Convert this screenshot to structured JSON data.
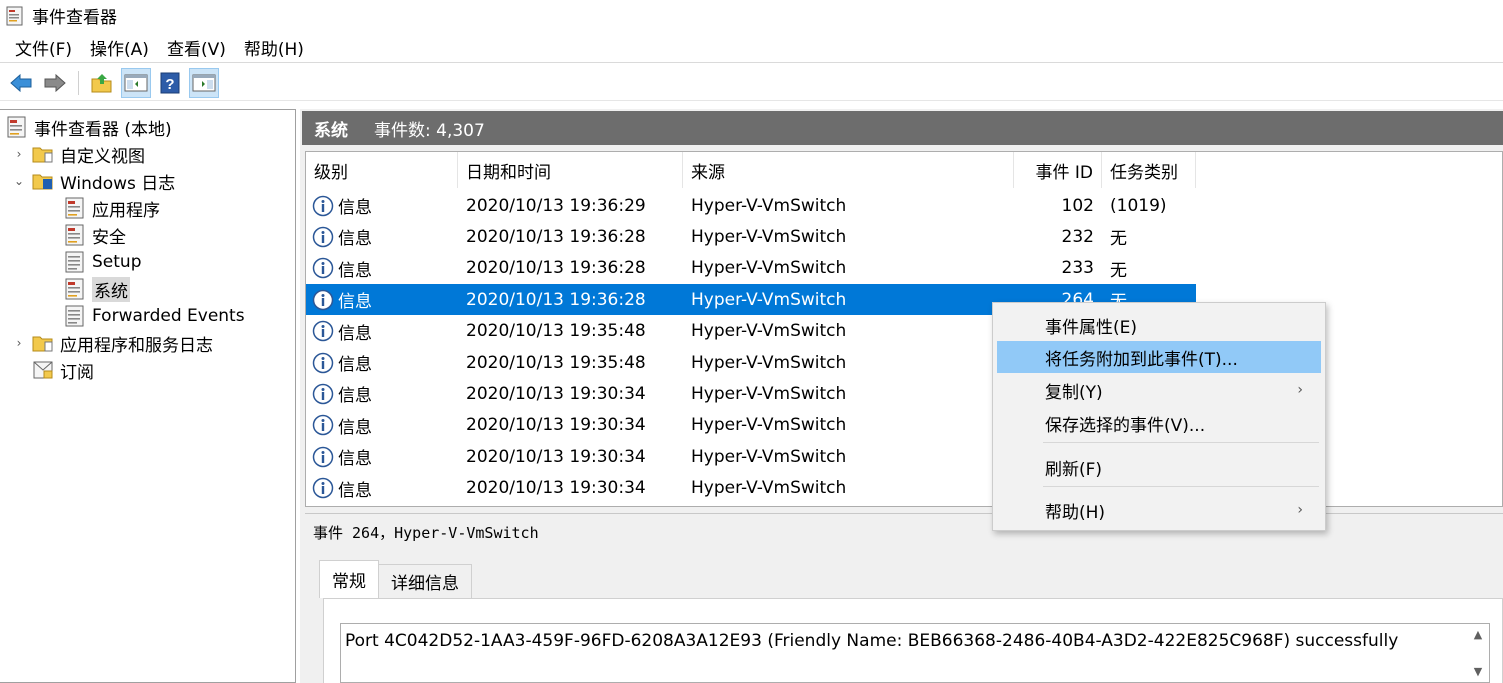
{
  "window": {
    "title": "事件查看器"
  },
  "menu": [
    {
      "label": "文件(F)"
    },
    {
      "label": "操作(A)"
    },
    {
      "label": "查看(V)"
    },
    {
      "label": "帮助(H)"
    }
  ],
  "toolbar": {
    "buttons": [
      "back-icon",
      "forward-icon",
      "folder-up-icon",
      "show-hide-tree-icon",
      "help-icon",
      "show-hide-action-pane-icon"
    ]
  },
  "tree": [
    {
      "label": "事件查看器 (本地)",
      "icon": "event-viewer-icon",
      "level": 0,
      "chev": ""
    },
    {
      "label": "自定义视图",
      "icon": "folder-icon",
      "level": 1,
      "chev": "›"
    },
    {
      "label": "Windows 日志",
      "icon": "windows-logs-icon",
      "level": 1,
      "chev": "⌄"
    },
    {
      "label": "应用程序",
      "icon": "log-icon",
      "level": 2,
      "chev": ""
    },
    {
      "label": "安全",
      "icon": "log-icon",
      "level": 2,
      "chev": ""
    },
    {
      "label": "Setup",
      "icon": "log-icon",
      "level": 2,
      "chev": ""
    },
    {
      "label": "系统",
      "icon": "log-icon",
      "level": 2,
      "chev": "",
      "selected": true
    },
    {
      "label": "Forwarded Events",
      "icon": "log-icon",
      "level": 2,
      "chev": ""
    },
    {
      "label": "应用程序和服务日志",
      "icon": "folder-icon",
      "level": 1,
      "chev": "›"
    },
    {
      "label": "订阅",
      "icon": "subscription-icon",
      "level": 1,
      "chev": ""
    }
  ],
  "list": {
    "title": "系统",
    "count": "事件数: 4,307",
    "columns": [
      "级别",
      "日期和时间",
      "来源",
      "事件 ID",
      "任务类别"
    ],
    "rows": [
      {
        "level": "信息",
        "datetime": "2020/10/13 19:36:29",
        "source": "Hyper-V-VmSwitch",
        "id": "102",
        "task": "(1019)"
      },
      {
        "level": "信息",
        "datetime": "2020/10/13 19:36:28",
        "source": "Hyper-V-VmSwitch",
        "id": "232",
        "task": "无"
      },
      {
        "level": "信息",
        "datetime": "2020/10/13 19:36:28",
        "source": "Hyper-V-VmSwitch",
        "id": "233",
        "task": "无"
      },
      {
        "level": "信息",
        "datetime": "2020/10/13 19:36:28",
        "source": "Hyper-V-VmSwitch",
        "id": "264",
        "task": "无",
        "selected": true
      },
      {
        "level": "信息",
        "datetime": "2020/10/13 19:35:48",
        "source": "Hyper-V-VmSwitch",
        "id": "",
        "task": ""
      },
      {
        "level": "信息",
        "datetime": "2020/10/13 19:35:48",
        "source": "Hyper-V-VmSwitch",
        "id": "",
        "task": ""
      },
      {
        "level": "信息",
        "datetime": "2020/10/13 19:30:34",
        "source": "Hyper-V-VmSwitch",
        "id": "",
        "task": ""
      },
      {
        "level": "信息",
        "datetime": "2020/10/13 19:30:34",
        "source": "Hyper-V-VmSwitch",
        "id": "",
        "task": ""
      },
      {
        "level": "信息",
        "datetime": "2020/10/13 19:30:34",
        "source": "Hyper-V-VmSwitch",
        "id": "",
        "task": ""
      },
      {
        "level": "信息",
        "datetime": "2020/10/13 19:30:34",
        "source": "Hyper-V-VmSwitch",
        "id": "",
        "task": ""
      }
    ]
  },
  "details": {
    "title": "事件 264，Hyper-V-VmSwitch",
    "tabs": [
      "常规",
      "详细信息"
    ],
    "description": "Port 4C042D52-1AA3-459F-96FD-6208A3A12E93 (Friendly Name: BEB66368-2486-40B4-A3D2-422E825C968F) successfully"
  },
  "context_menu": [
    {
      "label": "事件属性(E)"
    },
    {
      "label": "将任务附加到此事件(T)...",
      "highlighted": true
    },
    {
      "label": "复制(Y)",
      "submenu": true
    },
    {
      "label": "保存选择的事件(V)..."
    },
    {
      "label": "刷新(F)"
    },
    {
      "label": "帮助(H)",
      "submenu": true
    }
  ],
  "colors": {
    "selection": "#0078d7",
    "menu_highlight": "#91c9f7",
    "header_bar": "#6d6d6d"
  }
}
